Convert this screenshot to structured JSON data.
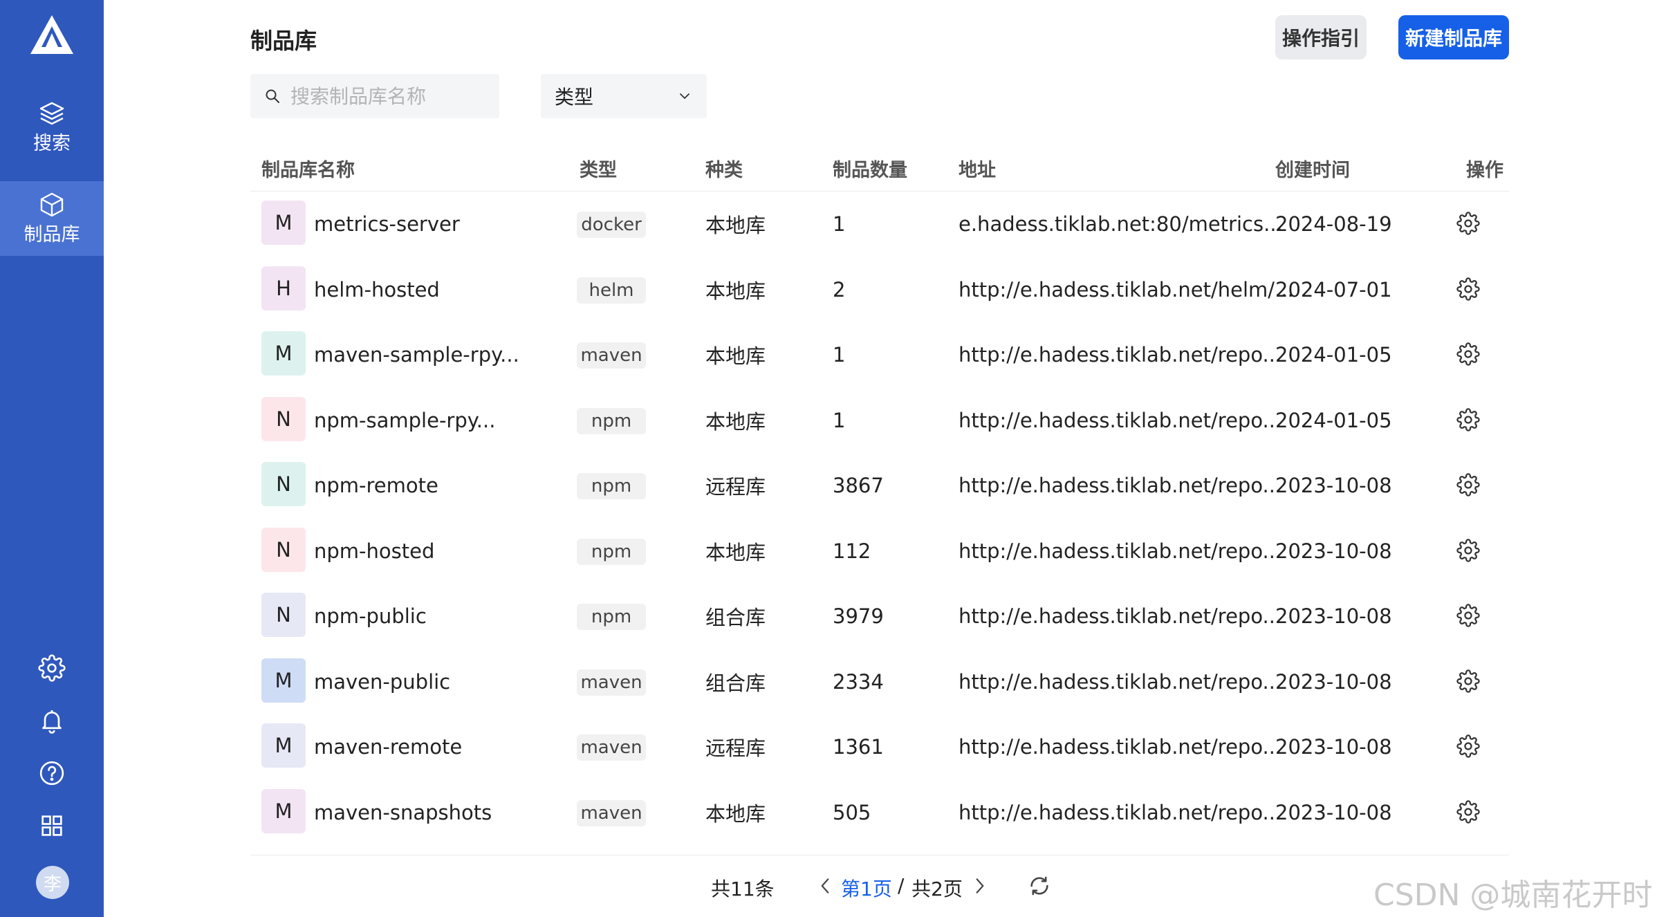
{
  "sidebar": {
    "items": [
      {
        "label": "搜索",
        "icon": "layers-icon"
      },
      {
        "label": "制品库",
        "icon": "cube-icon"
      }
    ],
    "bottom_icons": [
      "gear-icon",
      "bell-icon",
      "help-icon",
      "apps-grid-icon"
    ],
    "avatar": "李"
  },
  "header": {
    "title": "制品库",
    "guide_label": "操作指引",
    "new_label": "新建制品库"
  },
  "filters": {
    "search_placeholder": "搜索制品库名称",
    "type_label": "类型"
  },
  "table": {
    "headers": [
      "制品库名称",
      "类型",
      "种类",
      "制品数量",
      "地址",
      "创建时间",
      "操作"
    ],
    "rows": [
      {
        "letter": "M",
        "name": "metrics-server",
        "type": "docker",
        "kind": "本地库",
        "count": "1",
        "address": "e.hadess.tiklab.net:80/metrics...",
        "created": "2024-08-19",
        "color": "#f3e4f3"
      },
      {
        "letter": "H",
        "name": "helm-hosted",
        "type": "helm",
        "kind": "本地库",
        "count": "2",
        "address": "http://e.hadess.tiklab.net/helm/...",
        "created": "2024-07-01",
        "color": "#f3e4f3"
      },
      {
        "letter": "M",
        "name": "maven-sample-rpy...",
        "type": "maven",
        "kind": "本地库",
        "count": "1",
        "address": "http://e.hadess.tiklab.net/repo...",
        "created": "2024-01-05",
        "color": "#ddf2ee"
      },
      {
        "letter": "N",
        "name": "npm-sample-rpy...",
        "type": "npm",
        "kind": "本地库",
        "count": "1",
        "address": "http://e.hadess.tiklab.net/repo...",
        "created": "2024-01-05",
        "color": "#fde6ea"
      },
      {
        "letter": "N",
        "name": "npm-remote",
        "type": "npm",
        "kind": "远程库",
        "count": "3867",
        "address": "http://e.hadess.tiklab.net/repo...",
        "created": "2023-10-08",
        "color": "#ddf2ee"
      },
      {
        "letter": "N",
        "name": "npm-hosted",
        "type": "npm",
        "kind": "本地库",
        "count": "112",
        "address": "http://e.hadess.tiklab.net/repo...",
        "created": "2023-10-08",
        "color": "#fde6ea"
      },
      {
        "letter": "N",
        "name": "npm-public",
        "type": "npm",
        "kind": "组合库",
        "count": "3979",
        "address": "http://e.hadess.tiklab.net/repo...",
        "created": "2023-10-08",
        "color": "#e6e8f6"
      },
      {
        "letter": "M",
        "name": "maven-public",
        "type": "maven",
        "kind": "组合库",
        "count": "2334",
        "address": "http://e.hadess.tiklab.net/repo...",
        "created": "2023-10-08",
        "color": "#cfdcf5"
      },
      {
        "letter": "M",
        "name": "maven-remote",
        "type": "maven",
        "kind": "远程库",
        "count": "1361",
        "address": "http://e.hadess.tiklab.net/repo...",
        "created": "2023-10-08",
        "color": "#e6e8f6"
      },
      {
        "letter": "M",
        "name": "maven-snapshots",
        "type": "maven",
        "kind": "本地库",
        "count": "505",
        "address": "http://e.hadess.tiklab.net/repo...",
        "created": "2023-10-08",
        "color": "#f3e4f3"
      }
    ]
  },
  "pagination": {
    "total": "共11条",
    "current": "第1页",
    "separator": "/",
    "total_pages": "共2页"
  },
  "watermark": "CSDN @城南花开时",
  "colors": {
    "sidebar": "#2f58bd",
    "sidebar_active": "#4a72d2",
    "primary": "#1660e8"
  }
}
